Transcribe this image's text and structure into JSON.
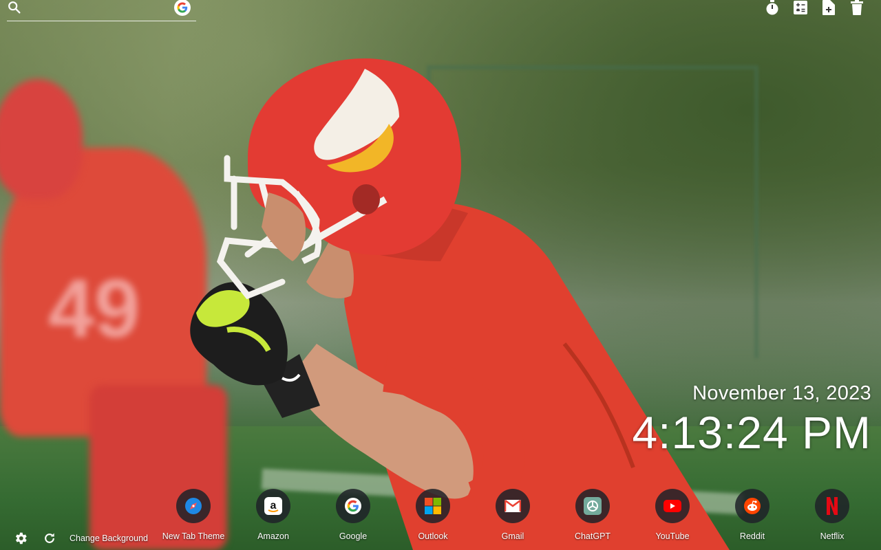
{
  "search": {
    "placeholder": ""
  },
  "toolbar": {
    "tools": [
      {
        "icon": "timer-icon"
      },
      {
        "icon": "calculator-icon"
      },
      {
        "icon": "new-note-icon"
      },
      {
        "icon": "trash-icon"
      }
    ]
  },
  "clock": {
    "date": "November 13, 2023",
    "time": "4:13:24 PM"
  },
  "shortcuts": [
    {
      "label": "New Tab Theme",
      "icon": "compass-icon"
    },
    {
      "label": "Amazon",
      "icon": "amazon-icon"
    },
    {
      "label": "Google",
      "icon": "google-icon"
    },
    {
      "label": "Outlook",
      "icon": "microsoft-icon"
    },
    {
      "label": "Gmail",
      "icon": "gmail-icon"
    },
    {
      "label": "ChatGPT",
      "icon": "chatgpt-icon"
    },
    {
      "label": "YouTube",
      "icon": "youtube-icon"
    },
    {
      "label": "Reddit",
      "icon": "reddit-icon"
    },
    {
      "label": "Netflix",
      "icon": "netflix-icon"
    }
  ],
  "bottom_bar": {
    "change_background_label": "Change Background"
  },
  "colors": {
    "jersey_red": "#e0402f",
    "helmet_red": "#e33b33",
    "field_green": "#356b32"
  }
}
